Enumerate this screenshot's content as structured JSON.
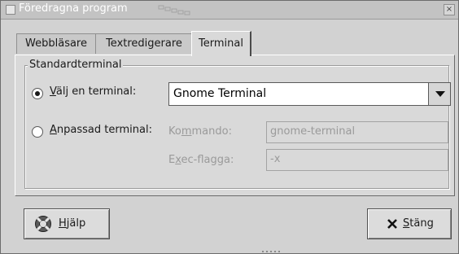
{
  "window": {
    "title": "Föredragna program",
    "close_glyph": "×"
  },
  "tabs": [
    {
      "label": "Webbläsare",
      "active": false
    },
    {
      "label": "Textredigerare",
      "active": false
    },
    {
      "label": "Terminal",
      "active": true
    }
  ],
  "section": {
    "legend": "Standardterminal",
    "choose": {
      "label_u": "V",
      "label_rest": "älj en terminal:",
      "selected": true,
      "combo_value": "Gnome Terminal"
    },
    "custom": {
      "label_u": "A",
      "label_rest": "npassad terminal:",
      "selected": false,
      "command_label_a": "Ko",
      "command_label_u": "m",
      "command_label_b": "mando:",
      "command_value": "gnome-terminal",
      "exec_label_a": "E",
      "exec_label_u": "x",
      "exec_label_b": "ec-flagga:",
      "exec_value": "-x"
    }
  },
  "buttons": {
    "help": {
      "label_u": "H",
      "label_rest": "jälp",
      "icon": "help-lifebuoy-icon"
    },
    "close": {
      "label_u": "S",
      "label_rest": "täng",
      "icon": "close-x-icon"
    }
  },
  "colors": {
    "titlebar": "#c3c3c3",
    "window_bg": "#d2d2d2",
    "notebook_bg": "#d9d9d9"
  }
}
